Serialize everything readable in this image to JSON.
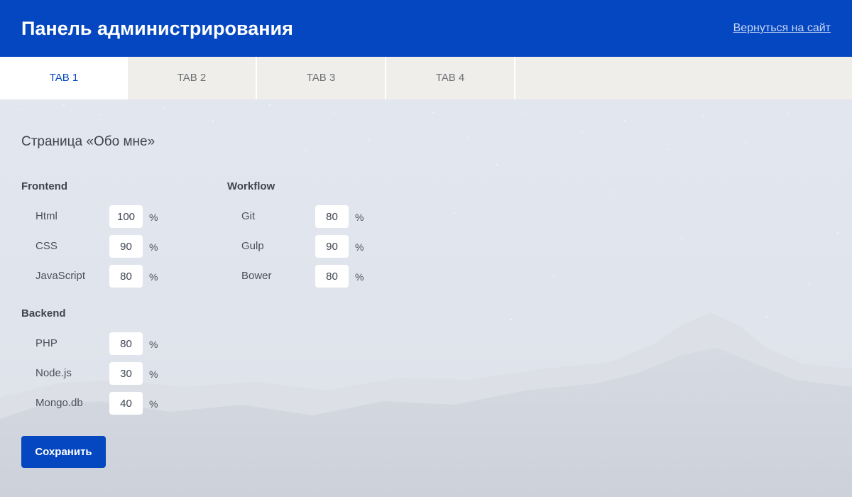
{
  "header": {
    "title": "Панель администрирования",
    "back_link": "Вернуться на сайт"
  },
  "tabs": [
    {
      "label": "TAB 1",
      "active": true
    },
    {
      "label": "TAB 2",
      "active": false
    },
    {
      "label": "TAB 3",
      "active": false
    },
    {
      "label": "TAB 4",
      "active": false
    }
  ],
  "page": {
    "title": "Страница «Обо мне»"
  },
  "groups": {
    "frontend": {
      "title": "Frontend",
      "skills": [
        {
          "name": "Html",
          "value": "100"
        },
        {
          "name": "CSS",
          "value": "90"
        },
        {
          "name": "JavaScript",
          "value": "80"
        }
      ]
    },
    "workflow": {
      "title": "Workflow",
      "skills": [
        {
          "name": "Git",
          "value": "80"
        },
        {
          "name": "Gulp",
          "value": "90"
        },
        {
          "name": "Bower",
          "value": "80"
        }
      ]
    },
    "backend": {
      "title": "Backend",
      "skills": [
        {
          "name": "PHP",
          "value": "80"
        },
        {
          "name": "Node.js",
          "value": "30"
        },
        {
          "name": "Mongo.db",
          "value": "40"
        }
      ]
    }
  },
  "unit": "%",
  "save_label": "Сохранить",
  "colors": {
    "brand": "#0447c1",
    "tab_bar": "#efeeea",
    "text": "#3d4350"
  }
}
